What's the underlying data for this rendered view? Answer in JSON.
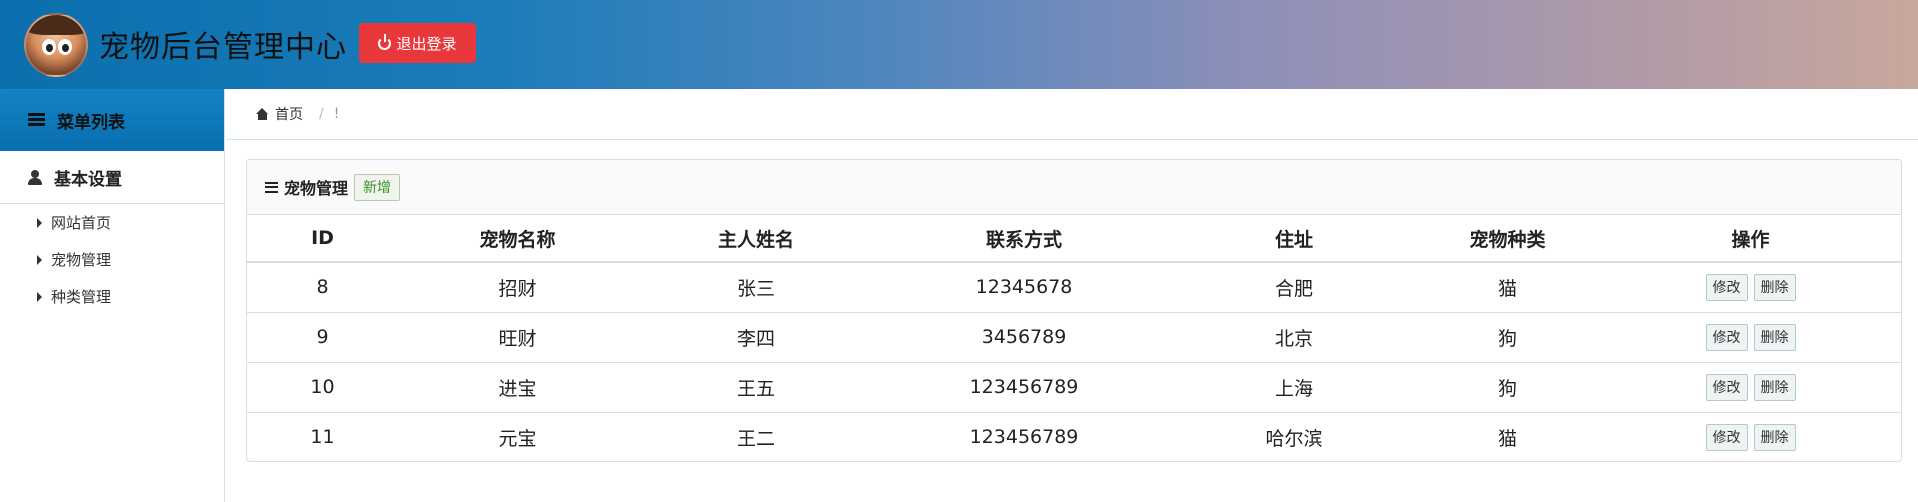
{
  "header": {
    "title": "宠物后台管理中心",
    "logout_label": "退出登录"
  },
  "sidebar": {
    "menu_title": "菜单列表",
    "group_title": "基本设置",
    "items": [
      {
        "label": "网站首页"
      },
      {
        "label": "宠物管理"
      },
      {
        "label": "种类管理"
      }
    ]
  },
  "breadcrumb": {
    "home": "首页",
    "separator": "/",
    "current": "!"
  },
  "panel": {
    "title": "宠物管理",
    "add_label": "新增"
  },
  "table": {
    "headers": [
      "ID",
      "宠物名称",
      "主人姓名",
      "联系方式",
      "住址",
      "宠物种类",
      "操作"
    ],
    "rows": [
      [
        "8",
        "招财",
        "张三",
        "12345678",
        "合肥",
        "猫"
      ],
      [
        "9",
        "旺财",
        "李四",
        "3456789",
        "北京",
        "狗"
      ],
      [
        "10",
        "进宝",
        "王五",
        "123456789",
        "上海",
        "狗"
      ],
      [
        "11",
        "元宝",
        "王二",
        "123456789",
        "哈尔滨",
        "猫"
      ]
    ],
    "edit_label": "修改",
    "delete_label": "删除"
  },
  "colors": {
    "logout": "#e8383c",
    "menu_head": "#0a6faf",
    "add_text": "#3e8f2e"
  }
}
